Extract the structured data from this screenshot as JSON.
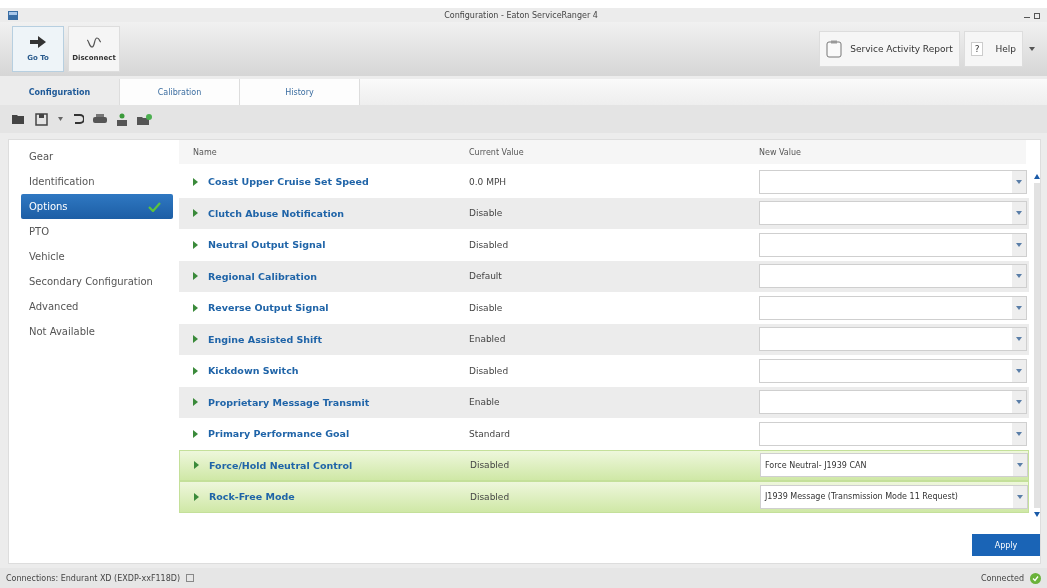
{
  "window": {
    "title": "Configuration - Eaton ServiceRanger 4"
  },
  "ribbon": {
    "buttons": [
      {
        "label": "Go To",
        "kind": "goto",
        "selected": true
      },
      {
        "label": "Disconnect",
        "kind": "disconnect",
        "selected": false
      }
    ],
    "right_buttons": [
      {
        "label": "Service Activity Report",
        "kind": "report"
      },
      {
        "label": "Help",
        "kind": "help",
        "icon": "?"
      }
    ]
  },
  "tabs": [
    {
      "label": "Configuration",
      "selected": true
    },
    {
      "label": "Calibration",
      "selected": false
    },
    {
      "label": "History",
      "selected": false
    }
  ],
  "sidebar": {
    "items": [
      {
        "label": "Gear",
        "selected": false,
        "checked": false
      },
      {
        "label": "Identification",
        "selected": false,
        "checked": false
      },
      {
        "label": "Options",
        "selected": true,
        "checked": true
      },
      {
        "label": "PTO",
        "selected": false,
        "checked": false
      },
      {
        "label": "Vehicle",
        "selected": false,
        "checked": false
      },
      {
        "label": "Secondary Configuration",
        "selected": false,
        "checked": false
      },
      {
        "label": "Advanced",
        "selected": false,
        "checked": false
      },
      {
        "label": "Not Available",
        "selected": false,
        "checked": false
      }
    ]
  },
  "table": {
    "columns": [
      "Name",
      "Current Value",
      "New Value"
    ],
    "rows": [
      {
        "name": "Coast Upper Cruise Set Speed",
        "current": "0.0 MPH",
        "changed": false
      },
      {
        "name": "Clutch Abuse Notification",
        "current": "Disable",
        "changed": false
      },
      {
        "name": "Neutral Output Signal",
        "current": "Disabled",
        "changed": false
      },
      {
        "name": "Regional Calibration",
        "current": "Default",
        "changed": false
      },
      {
        "name": "Reverse Output Signal",
        "current": "Disable",
        "changed": false
      },
      {
        "name": "Engine Assisted Shift",
        "current": "Enabled",
        "changed": false
      },
      {
        "name": "Kickdown Switch",
        "current": "Disabled",
        "changed": false
      },
      {
        "name": "Proprietary Message Transmit",
        "current": "Enable",
        "changed": false
      },
      {
        "name": "Primary Performance Goal",
        "current": "Standard",
        "changed": false
      },
      {
        "name": "Force/Hold Neutral Control",
        "current": "Disabled",
        "changed": true,
        "new": "Force Neutral- J1939 CAN"
      },
      {
        "name": "Rock-Free Mode",
        "current": "Disabled",
        "changed": true,
        "new": "J1939 Message (Transmission Mode 11 Request)"
      }
    ]
  },
  "apply_button": "Apply",
  "status_bar": {
    "connection": "Connections: Endurant XD (EXDP-xxF118D)",
    "status": "Connected"
  }
}
